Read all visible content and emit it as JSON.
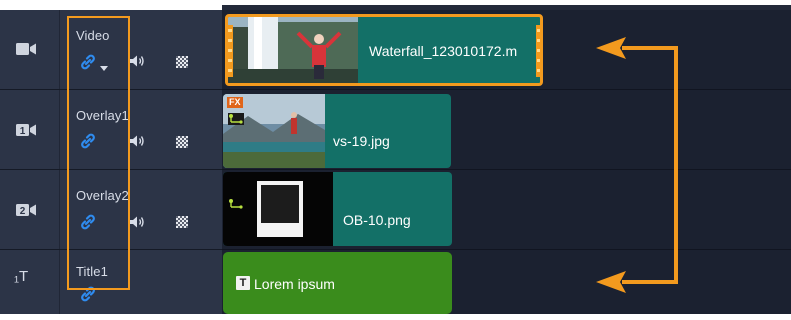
{
  "tracks": [
    {
      "name": "Video",
      "icon": "video-track-icon",
      "has_audio": true,
      "has_checker": true,
      "link_dropdown": true
    },
    {
      "name": "Overlay1",
      "icon": "overlay-1-track-icon",
      "badge": "1",
      "has_audio": true,
      "has_checker": true
    },
    {
      "name": "Overlay2",
      "icon": "overlay-2-track-icon",
      "badge": "2",
      "has_audio": true,
      "has_checker": true
    },
    {
      "name": "Title1",
      "icon": "title-track-icon",
      "icon_text": "₁T",
      "has_audio": false,
      "has_checker": false
    }
  ],
  "clips": {
    "video": {
      "label": "Waterfall_123010172.m"
    },
    "overlay1": {
      "label": "vs-19.jpg",
      "fx_badge": "FX"
    },
    "overlay2": {
      "label": "OB-10.png"
    },
    "title": {
      "label": "Lorem ipsum",
      "icon_letter": "T"
    }
  },
  "colors": {
    "header_bg": "#2c3447",
    "timeline_bg": "#1b2130",
    "clip_teal": "#137067",
    "clip_green": "#3a8c1c",
    "highlight": "#f39a1e",
    "link_blue": "#2f8cf0"
  }
}
